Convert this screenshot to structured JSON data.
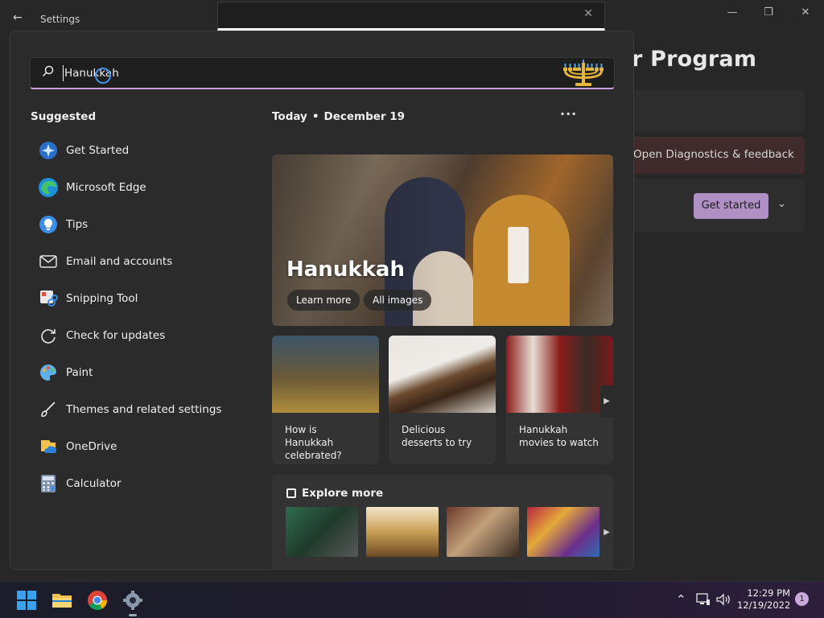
{
  "background_window": {
    "back_glyph": "←",
    "title": "Settings",
    "heading": "r Program",
    "diagnostics_link": "Open Diagnostics & feedback",
    "get_started_label": "Get started",
    "accent_color": "#b090c4"
  },
  "search": {
    "query": "Hanukkah"
  },
  "suggested": {
    "title": "Suggested",
    "items": [
      {
        "label": "Get Started",
        "icon": "get-started-icon"
      },
      {
        "label": "Microsoft Edge",
        "icon": "edge-icon"
      },
      {
        "label": "Tips",
        "icon": "tips-icon"
      },
      {
        "label": "Email and accounts",
        "icon": "email-icon"
      },
      {
        "label": "Snipping Tool",
        "icon": "snipping-tool-icon"
      },
      {
        "label": "Check for updates",
        "icon": "update-icon"
      },
      {
        "label": "Paint",
        "icon": "paint-icon"
      },
      {
        "label": "Themes and related settings",
        "icon": "brush-icon"
      },
      {
        "label": "OneDrive",
        "icon": "onedrive-icon"
      },
      {
        "label": "Calculator",
        "icon": "calculator-icon"
      }
    ]
  },
  "highlights": {
    "today_label": "Today",
    "date": "December 19",
    "more_glyph": "···",
    "hero": {
      "title": "Hanukkah",
      "learn_more": "Learn more",
      "all_images": "All images"
    },
    "cards": [
      {
        "text": "How is Hanukkah celebrated?"
      },
      {
        "text": "Delicious desserts to try"
      },
      {
        "text": "Hanukkah movies to watch"
      }
    ],
    "explore_title": "Explore more"
  },
  "taskbar": {
    "time": "12:29 PM",
    "date": "12/19/2022",
    "notification_count": "1"
  }
}
